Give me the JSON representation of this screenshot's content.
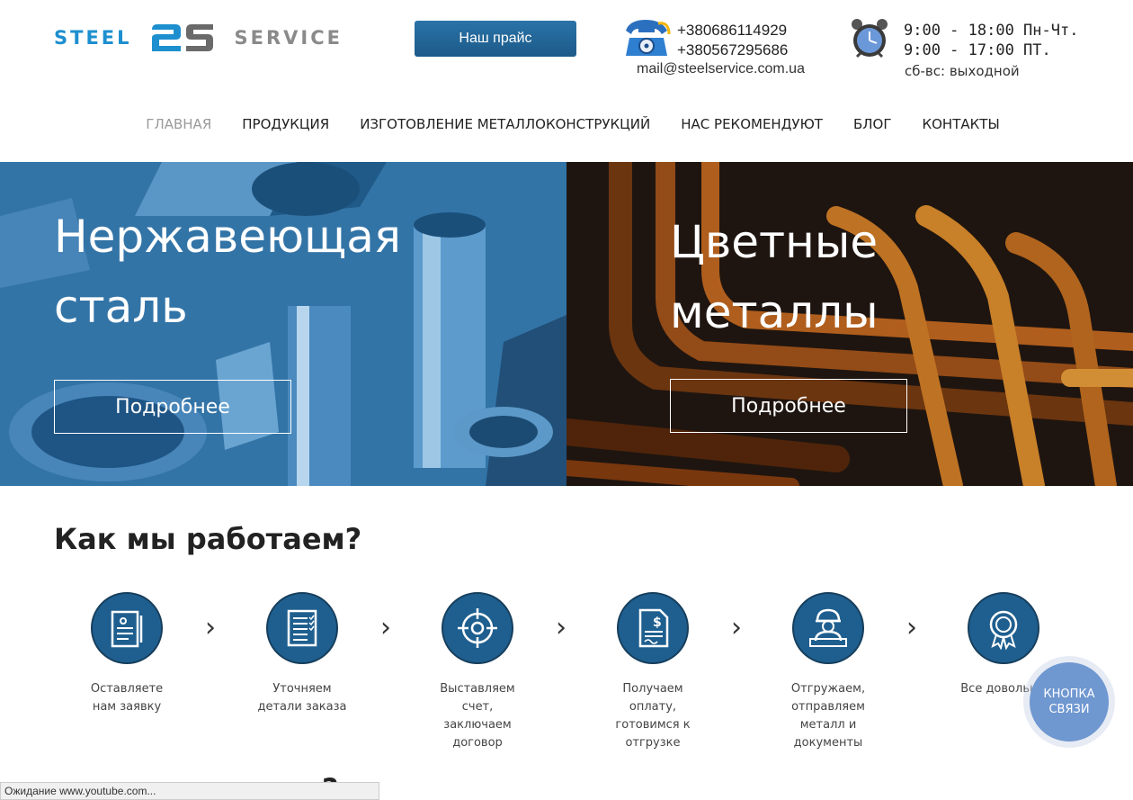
{
  "header": {
    "logo_left": "STEEL",
    "logo_mark": "2S",
    "logo_right": "SERVICE",
    "price_button": "Наш прайс",
    "phone_1": "+380686114929",
    "phone_2": "+380567295686",
    "email": "mail@steelservice.com.ua",
    "hours_1": "9:00 - 18:00 Пн-Чт.",
    "hours_2": "9:00 - 17:00 ПТ.",
    "hours_3": "сб-вс: выходной"
  },
  "nav": {
    "items": [
      {
        "label": "ГЛАВНАЯ",
        "active": true
      },
      {
        "label": "ПРОДУКЦИЯ",
        "active": false
      },
      {
        "label": "ИЗГОТОВЛЕНИЕ МЕТАЛЛОКОНСТРУКЦИЙ",
        "active": false
      },
      {
        "label": "НАС РЕКОМЕНДУЮТ",
        "active": false
      },
      {
        "label": "БЛОГ",
        "active": false
      },
      {
        "label": "КОНТАКТЫ",
        "active": false
      }
    ]
  },
  "hero": {
    "left": {
      "title_line1": "Нержавеющая",
      "title_line2": "сталь",
      "button": "Подробнее"
    },
    "right": {
      "title_line1": "Цветные",
      "title_line2": "металлы",
      "button": "Подробнее"
    }
  },
  "how": {
    "title": "Как мы работаем?",
    "steps": [
      {
        "icon": "application-form-icon",
        "lines": [
          "Оставляете",
          "нам заявку"
        ]
      },
      {
        "icon": "checklist-icon",
        "lines": [
          "Уточняем",
          "детали заказа"
        ]
      },
      {
        "icon": "target-icon",
        "lines": [
          "Выставляем",
          "счет,",
          "заключаем",
          "договор"
        ]
      },
      {
        "icon": "invoice-dollar-icon",
        "lines": [
          "Получаем",
          "оплату,",
          "готовимся к",
          "отгрузке"
        ]
      },
      {
        "icon": "worker-icon",
        "lines": [
          "Отгружаем,",
          "отправляем",
          "металл и",
          "документы"
        ]
      },
      {
        "icon": "award-badge-icon",
        "lines": [
          "Все довольны"
        ]
      }
    ]
  },
  "next_section_title_partial": "ас?",
  "status_bar": "Ожидание www.youtube.com...",
  "callback": {
    "line1": "КНОПКА",
    "line2": "СВЯЗИ"
  },
  "colors": {
    "accent_blue": "#1f5f8f",
    "logo_blue": "#1d8fcf",
    "price_button": "#1c5a88",
    "callback": "#6f97d0"
  }
}
